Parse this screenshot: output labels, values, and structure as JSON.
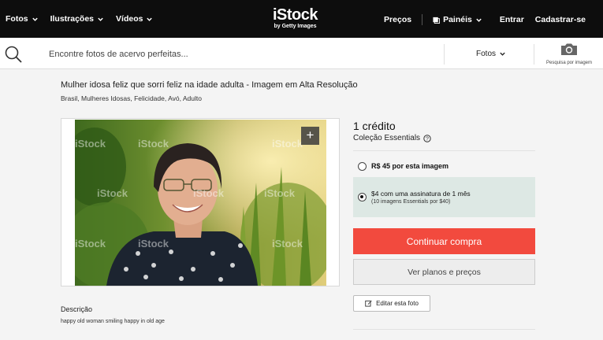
{
  "nav": {
    "left": [
      {
        "label": "Fotos"
      },
      {
        "label": "Ilustrações"
      },
      {
        "label": "Vídeos"
      }
    ],
    "logo_main": "iStock",
    "logo_sub": "by Getty Images",
    "prices": "Preços",
    "boards": "Painéis",
    "login": "Entrar",
    "signup": "Cadastrar-se"
  },
  "search": {
    "placeholder": "Encontre fotos de acervo perfeitas...",
    "filter": "Fotos",
    "image_search_label": "Pesquisa por imagem"
  },
  "asset": {
    "title": "Mulher idosa feliz que sorri feliz na idade adulta - Imagem em Alta Resolução",
    "tags": [
      "Brasil",
      "Mulheres Idosas",
      "Felicidade",
      "Avó",
      "Adulto"
    ],
    "watermark": "iStock",
    "description_heading": "Descrição",
    "description": "happy old woman smiling happy in old age"
  },
  "purchase": {
    "credits": "1 crédito",
    "collection": "Coleção Essentials",
    "option1": "R$ 45 por esta imagem",
    "option2_main": "$4 com uma assinatura de 1 mês",
    "option2_sub": "(10 imagens Essentials por $40)",
    "buy_button": "Continuar compra",
    "plans_button": "Ver planos e preços",
    "edit_button": "Editar esta foto"
  },
  "colors": {
    "nav_bg": "#0d0d0d",
    "buy_red": "#f24a3e",
    "selected_option_bg": "#dde8e4"
  }
}
